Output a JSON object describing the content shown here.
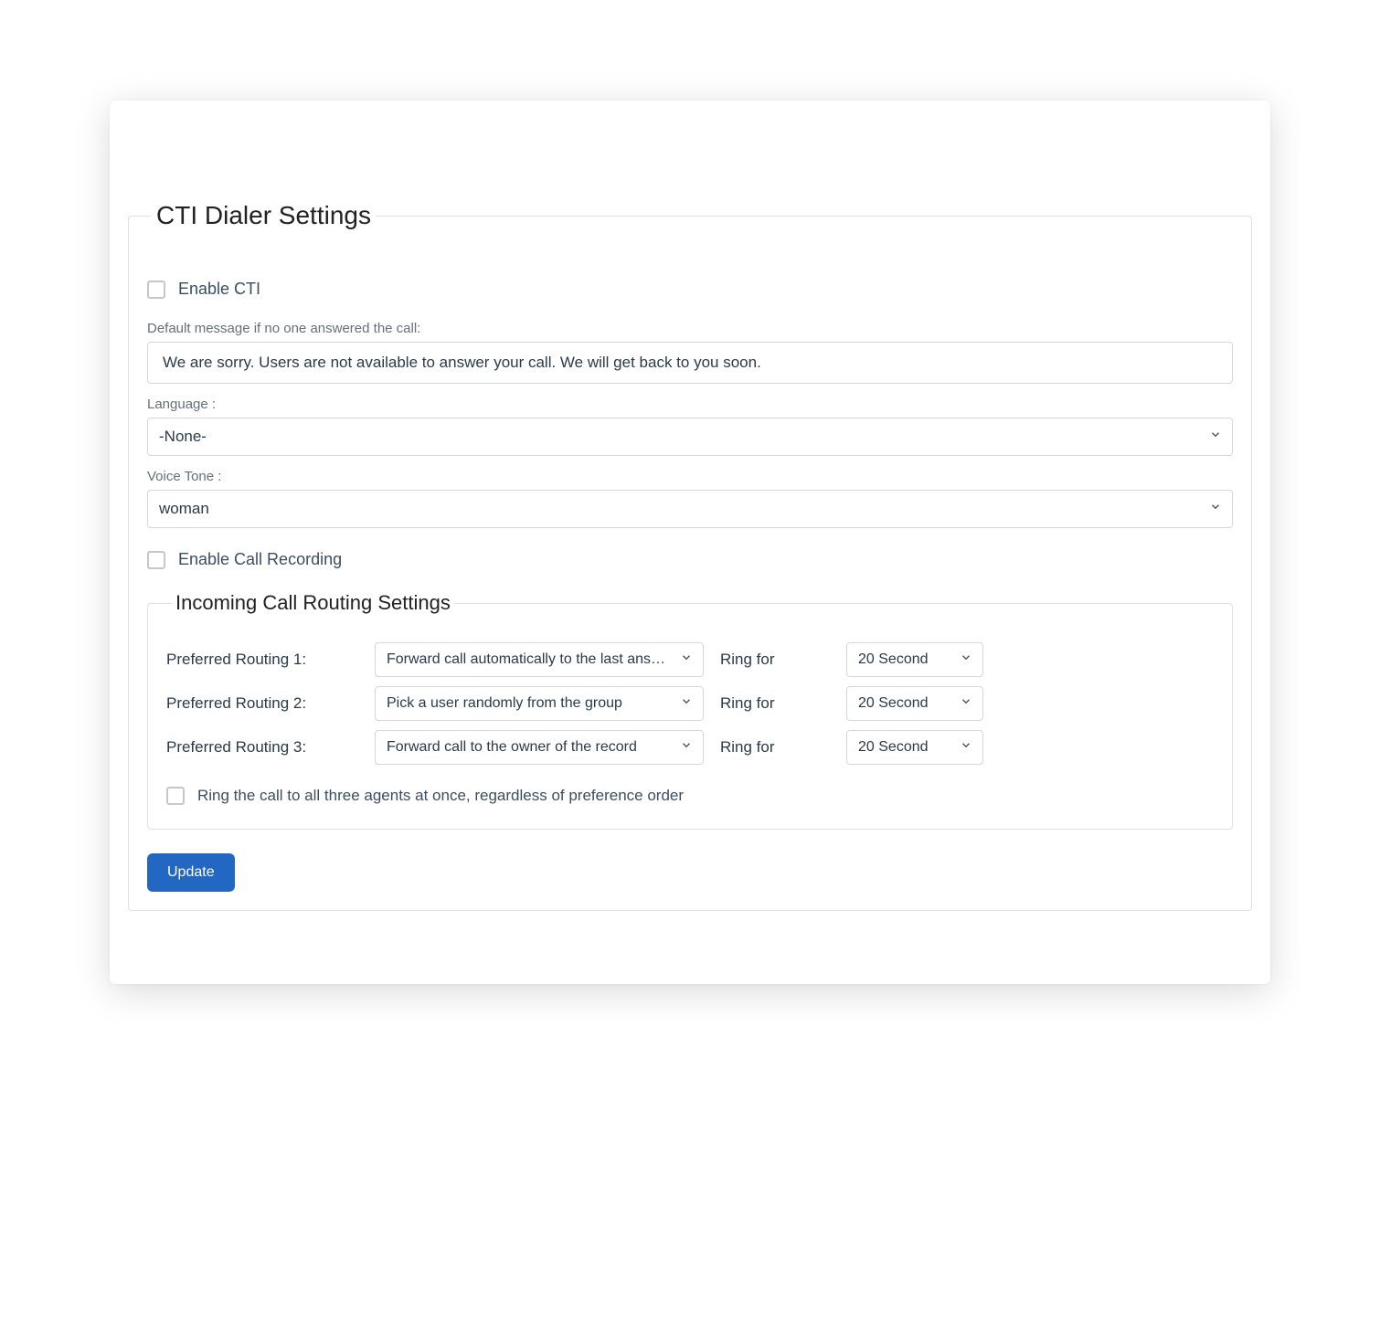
{
  "main": {
    "legend": "CTI Dialer Settings",
    "enable_cti_label": "Enable CTI",
    "default_msg_label": "Default message if no one answered the call:",
    "default_msg_value": "We are sorry. Users are not available to answer your call. We will get back to you soon.",
    "language_label": "Language :",
    "language_value": "-None-",
    "voice_tone_label": "Voice Tone :",
    "voice_tone_value": "woman",
    "enable_recording_label": "Enable Call Recording"
  },
  "routing": {
    "legend": "Incoming Call Routing Settings",
    "rows": [
      {
        "label": "Preferred Routing 1:",
        "rule": "Forward call automatically to the last answered",
        "ring_label": "Ring for",
        "ring_value": "20 Second"
      },
      {
        "label": "Preferred Routing 2:",
        "rule": "Pick a user randomly from the group",
        "ring_label": "Ring for",
        "ring_value": "20 Second"
      },
      {
        "label": "Preferred Routing 3:",
        "rule": "Forward call to the owner of the record",
        "ring_label": "Ring for",
        "ring_value": "20 Second"
      }
    ],
    "ring_all_label": "Ring the call to all three agents at once, regardless of preference order"
  },
  "actions": {
    "update_label": "Update"
  }
}
